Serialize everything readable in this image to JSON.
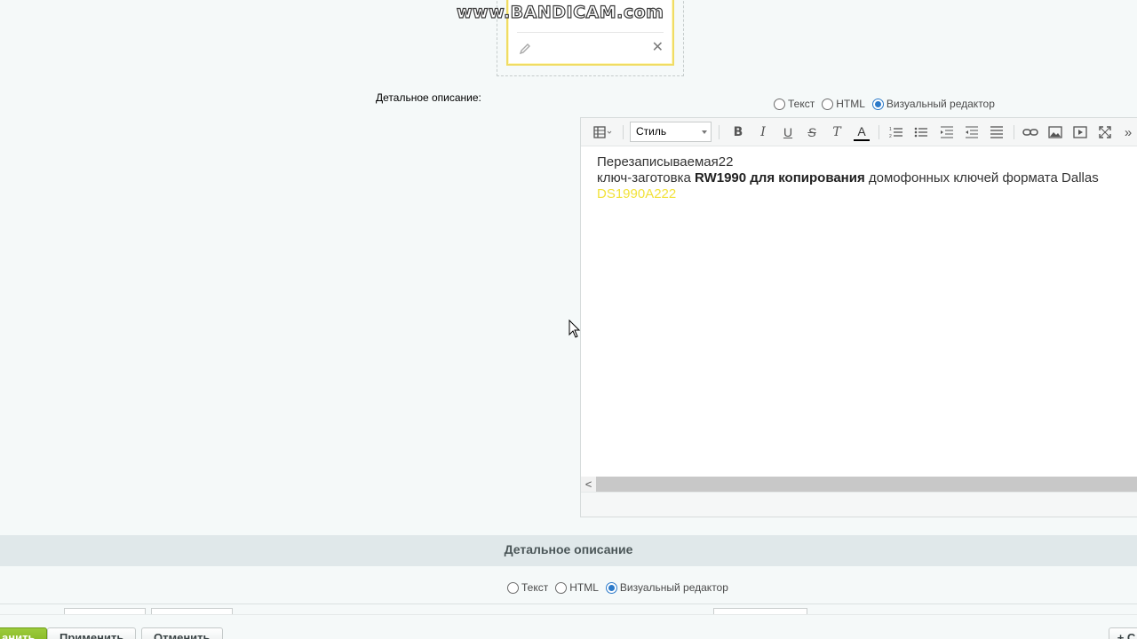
{
  "watermark": "www.BANDICAM.com",
  "detail_field": {
    "label": "Детальное описание:",
    "modes": [
      {
        "label": "Текст",
        "checked": false
      },
      {
        "label": "HTML",
        "checked": false
      },
      {
        "label": "Визуальный редактор",
        "checked": true
      }
    ]
  },
  "editor": {
    "style_select": "Стиль",
    "toolbar_icons": [
      "layout-icon",
      "bold-icon",
      "italic-icon",
      "underline-icon",
      "strikethrough-icon",
      "clear-format-icon",
      "font-color-icon",
      "ordered-list-icon",
      "unordered-list-icon",
      "outdent-icon",
      "indent-icon",
      "align-icon",
      "link-icon",
      "image-icon",
      "video-icon",
      "fullscreen-icon",
      "more-icon"
    ],
    "bold_label": "B",
    "italic_label": "I",
    "underline_label": "U",
    "strike_label": "S",
    "clear_label": "T",
    "color_label": "A",
    "more_label": "»",
    "content": {
      "line1": "Перезаписываемая22",
      "line2_prefix": "ключ-заготовка ",
      "line2_bold": "RW1990 для копирования",
      "line2_suffix": " домофонных ключей формата Dallas",
      "line3": "DS1990A222"
    },
    "scroll_left": "<"
  },
  "section": {
    "title": "Детальное описание",
    "modes": [
      {
        "label": "Текст",
        "checked": false
      },
      {
        "label": "HTML",
        "checked": false
      },
      {
        "label": "Визуальный редактор",
        "checked": true
      }
    ]
  },
  "actions": {
    "save": "анить",
    "apply": "Применить",
    "cancel": "Отменить",
    "plus": "+ С"
  },
  "colors": {
    "accent": "#2c7ac9",
    "save_button": "#8bbd2a",
    "highlight_text": "#f2e23a",
    "card_border": "#f0dc63"
  }
}
